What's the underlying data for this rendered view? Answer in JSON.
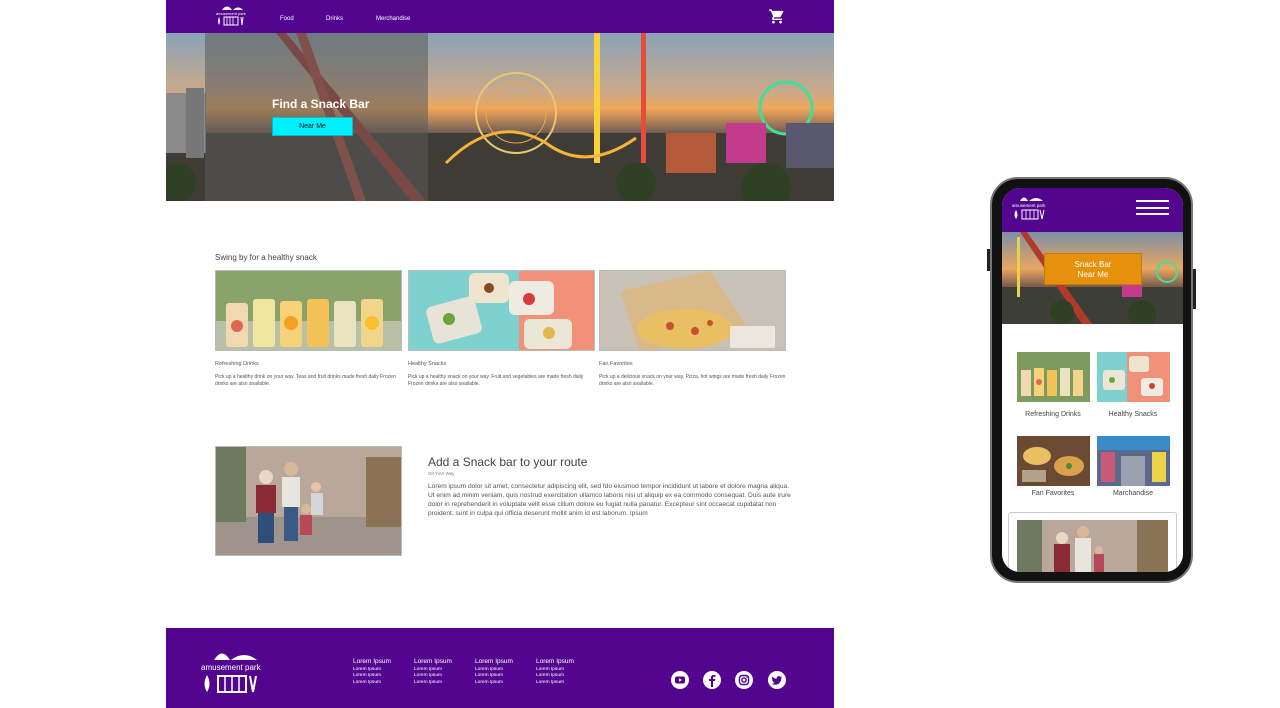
{
  "desktop": {
    "logo_text": "amusement park",
    "nav": {
      "food": "Food",
      "drinks": "Drinks",
      "merch": "Merchandise"
    },
    "hero": {
      "title": "Find a Snack Bar",
      "button": "Near Me"
    },
    "section_title": "Swing by for a healthy snack",
    "cards": [
      {
        "title": "Refreshing Drinks",
        "desc": "Pick up a healthy drink on your way. Teas and fruit drinks made fresh daily Frozen drinks are also available."
      },
      {
        "title": "Healthy Snacks",
        "desc": "Pick up a healthy snack on your way. Fruit and vegetables are made fresh daily Frozen drinks are also available."
      },
      {
        "title": "Fan Favorites",
        "desc": "Pick up a delicious snack on your way. Pizza, hot wings are made fresh daily Frozen drinks are also available."
      }
    ],
    "route": {
      "title": "Add a Snack bar to your route",
      "subtitle": "On Your Way",
      "text": "Lorem ipsum dolor sit amet, consectetur adipiscing elit, sed fdo eiusmod tempor incididunt ut labore et dolore magna aliqua. Ut enim ad minim veniam, quis nostrud exercitation ullamco laboris nisi ut aliquip ex ea commodo consequat. Duis aute irure dolor in reprehenderit in voluptate velit esse cillum dolore eu fugiat nulla panatur. Excepteur sint occaecat cupidatat non proident, sunt in culpa qui officia deserunt mollit anim id est laborum. Ipsum"
    },
    "footer": {
      "logo_text": "amusement park",
      "columns": [
        {
          "heading": "Lorem Ipsum",
          "links": [
            "Lorem Ipsum",
            "Lorem Ipsum",
            "Lorem Ipsum"
          ]
        },
        {
          "heading": "Lorem Ipsum",
          "links": [
            "Lorem Ipsum",
            "Lorem Ipsum",
            "Lorem Ipsum"
          ]
        },
        {
          "heading": "Lorem Ipsum",
          "links": [
            "Lorem Ipsum",
            "Lorem Ipsum",
            "Lorem Ipsum"
          ]
        },
        {
          "heading": "Lorem Ipsum",
          "links": [
            "Lorem Ipsum",
            "Lorem Ipsum",
            "Lorem Ipsum"
          ]
        }
      ],
      "social": [
        "youtube-icon",
        "facebook-icon",
        "instagram-icon",
        "twitter-icon"
      ]
    }
  },
  "mobile": {
    "logo_text": "amusement park",
    "hero_button_line1": "Snack Bar",
    "hero_button_line2": "Near Me",
    "tiles": [
      "Refreshing Drinks",
      "Healthy Snacks",
      "Fan Favorites",
      "Marchandise"
    ]
  },
  "colors": {
    "brand": "#54058f",
    "cta_desktop": "#00f0ff",
    "cta_mobile": "#e6910d"
  }
}
